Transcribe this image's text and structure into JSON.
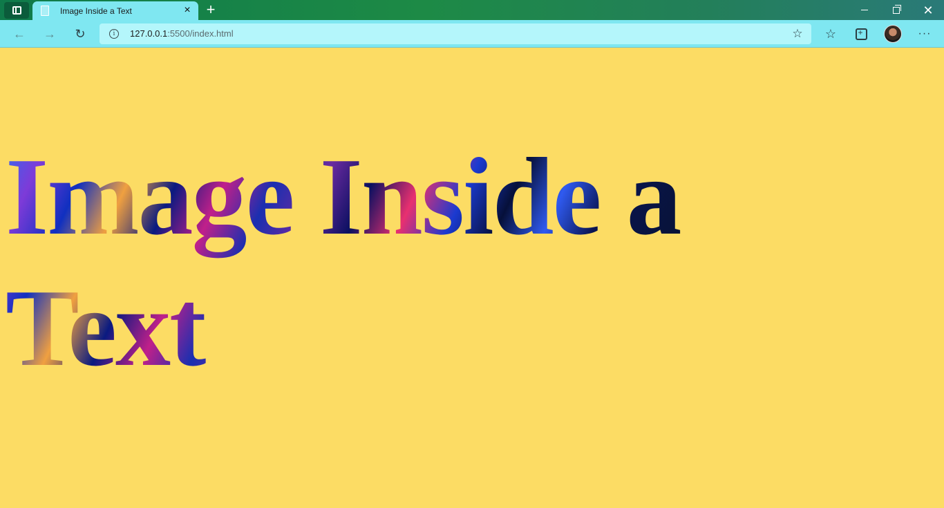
{
  "window": {
    "tab_title": "Image Inside a Text",
    "tab_icon": "page-icon",
    "new_tab_icon": "plus-icon",
    "controls": [
      "minimize-icon",
      "restore-icon",
      "close-icon"
    ]
  },
  "toolbar": {
    "url_host": "127.0.0.1",
    "url_rest": ":5500/index.html",
    "icons": [
      "back-arrow-icon",
      "forward-arrow-icon",
      "refresh-icon",
      "info-icon",
      "add-favorite-icon",
      "favorites-icon",
      "collections-icon",
      "profile-avatar",
      "more-icon"
    ]
  },
  "page": {
    "heading": "Image Inside a Text",
    "background_color": "#fcdc64"
  },
  "colors": {
    "tab_bar": "#1d8a46",
    "toolbar": "#7fe7f1",
    "address_bar": "#b4f6fb"
  }
}
